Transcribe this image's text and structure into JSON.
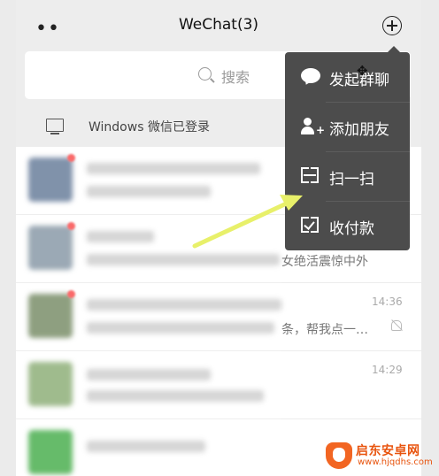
{
  "header": {
    "more_label": "••",
    "title": "WeChat(3)",
    "add_icon": "plus-circle-icon"
  },
  "search": {
    "placeholder": "搜索",
    "icon": "search-icon"
  },
  "windows_bar": {
    "icon": "monitor-icon",
    "text": "Windows 微信已登录"
  },
  "chats": [
    {
      "preview_tail": "",
      "time": "",
      "unread": true,
      "avatar_color": "#6a7f9c"
    },
    {
      "preview_tail": "女绝活震惊中外",
      "time": "",
      "unread": true,
      "avatar_color": "#8a9aa8"
    },
    {
      "preview_tail": "条，帮我点一…",
      "time": "14:36",
      "unread": true,
      "muted": true,
      "avatar_color": "#7b8f6a"
    },
    {
      "preview_tail": "",
      "time": "14:29",
      "unread": false,
      "avatar_color": "#8fb07a"
    },
    {
      "preview_tail": "",
      "time": "",
      "unread": false,
      "avatar_color": "#4caf50"
    }
  ],
  "menu": {
    "items": [
      {
        "label": "发起群聊",
        "icon": "chat-bubble-icon"
      },
      {
        "label": "添加朋友",
        "icon": "add-friend-icon"
      },
      {
        "label": "扫一扫",
        "icon": "scan-icon"
      },
      {
        "label": "收付款",
        "icon": "payment-scan-icon"
      }
    ]
  },
  "annotation": {
    "arrow_color": "#e8f06a"
  },
  "watermark": {
    "name": "启东安卓网",
    "url": "www.hjqdhs.com"
  },
  "colors": {
    "menu_bg": "#4c4c4c",
    "badge": "#fa5151",
    "watermark": "#e8540e"
  }
}
